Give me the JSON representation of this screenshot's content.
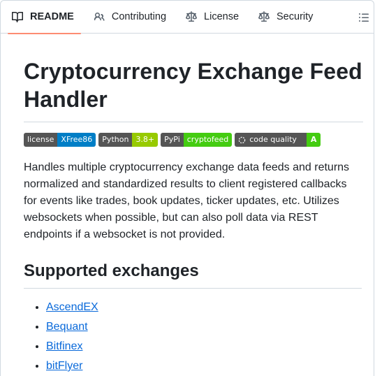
{
  "tabs": [
    {
      "label": "README",
      "icon": "book-icon",
      "active": true
    },
    {
      "label": "Contributing",
      "icon": "people-icon"
    },
    {
      "label": "License",
      "icon": "law-icon"
    },
    {
      "label": "Security",
      "icon": "law-icon"
    }
  ],
  "toc_icon": "list-unordered-icon",
  "title": "Cryptocurrency Exchange Feed Handler",
  "badges": [
    {
      "left": "license",
      "right": "XFree86",
      "color": "#007ec6"
    },
    {
      "left": "Python",
      "right": "3.8+",
      "color": "#97ca00"
    },
    {
      "left": "PyPi",
      "right": "cryptofeed",
      "color": "#4c1"
    },
    {
      "left": "code quality",
      "right": "A",
      "color": "#4c1",
      "icon": "codacy-icon"
    }
  ],
  "description": "Handles multiple cryptocurrency exchange data feeds and returns normalized and standardized results to client registered callbacks for events like trades, book updates, ticker updates, etc. Utilizes websockets when possible, but can also poll data via REST endpoints if a websocket is not provided.",
  "section_title": "Supported exchanges",
  "exchanges": [
    "AscendEX",
    "Bequant",
    "Bitfinex",
    "bitFlyer"
  ],
  "colors": {
    "accent_underline": "#fd8c73",
    "link": "#0969da"
  }
}
